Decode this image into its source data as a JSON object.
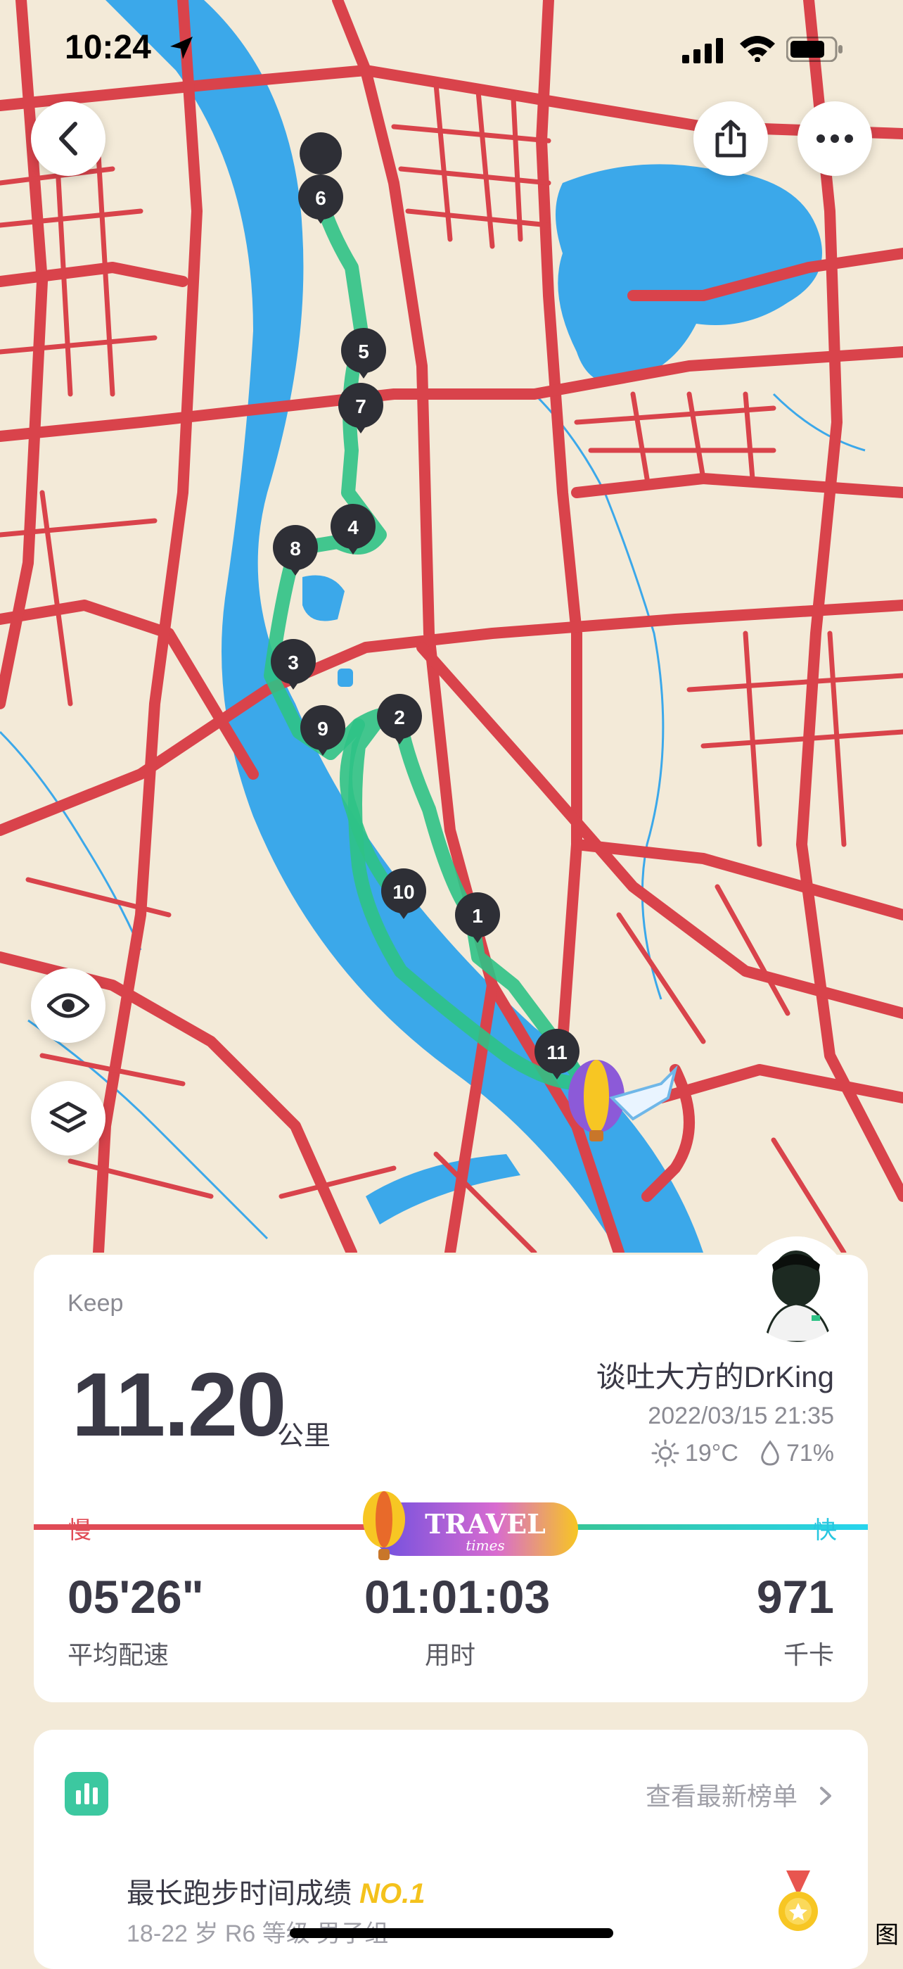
{
  "status_bar": {
    "time": "10:24"
  },
  "map": {
    "markers": [
      "1",
      "2",
      "3",
      "4",
      "5",
      "6",
      "7",
      "8",
      "9",
      "10",
      "11"
    ],
    "colors": {
      "land": "#f3ead8",
      "road": "#d9434b",
      "water": "#3ba8ea",
      "route": "#2fc286"
    }
  },
  "summary": {
    "source": "Keep",
    "distance": "11.20",
    "distance_unit": "公里",
    "username": "谈吐大方的DrKing",
    "datetime": "2022/03/15 21:35",
    "temperature": "19°C",
    "humidity": "71%",
    "slow_label": "慢",
    "fast_label": "快",
    "badge_text": "TRAVEL",
    "badge_sub": "times",
    "pace_value": "05'26\"",
    "pace_label": "平均配速",
    "duration_value": "01:01:03",
    "duration_label": "用时",
    "calories_value": "971",
    "calories_label": "千卡"
  },
  "ranking": {
    "link_text": "查看最新榜单",
    "title": "最长跑步时间成绩",
    "rank": "NO.1",
    "subtitle": "18-22 岁 R6 等级 男子组"
  },
  "partial_text": "图"
}
